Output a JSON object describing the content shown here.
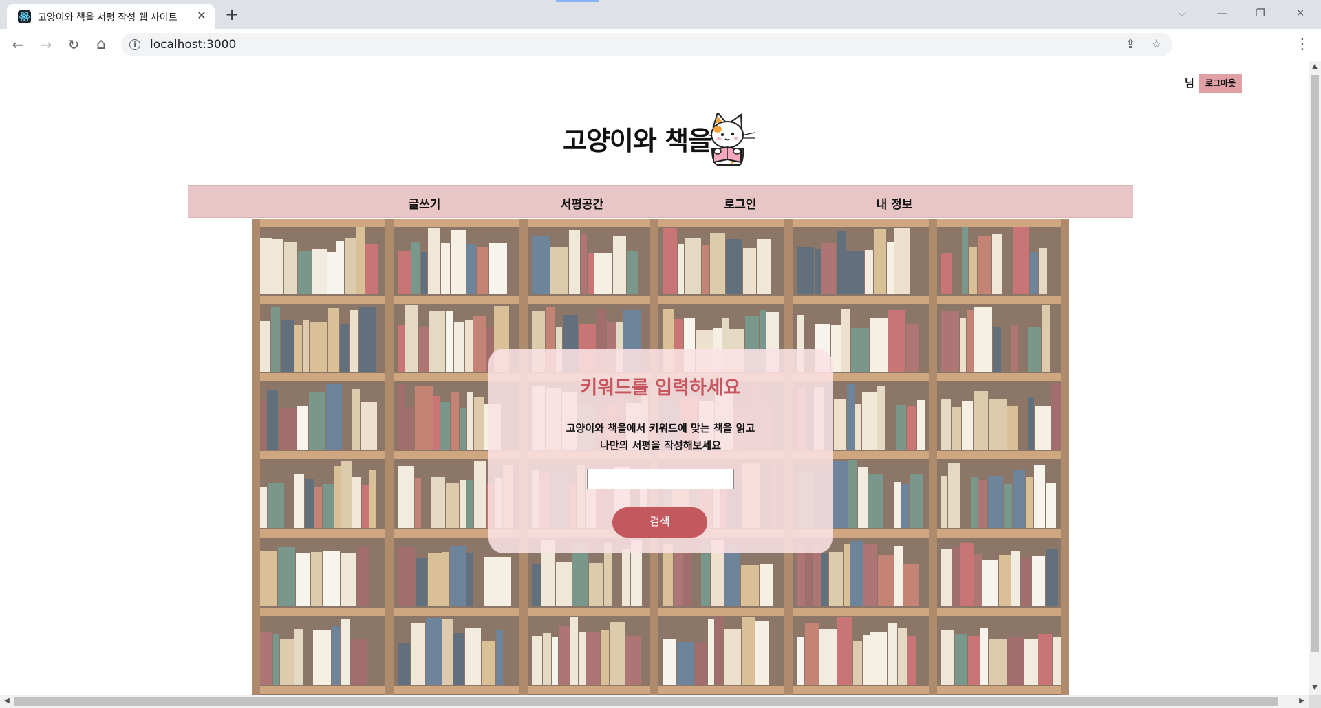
{
  "browser": {
    "tab_title": "고양이와 책을 서평 작성 웹 사이트",
    "tab_close": "✕",
    "new_tab": "+",
    "url": "localhost:3000",
    "controls": {
      "tab_search": "⌵",
      "minimize": "—",
      "restore": "❐",
      "close": "✕"
    },
    "nav": {
      "back": "←",
      "forward": "→",
      "reload": "↻",
      "home": "⌂",
      "menu": "⋮"
    },
    "omnibox_icons": {
      "info": "i",
      "share": "⇪",
      "bookmark": "☆"
    }
  },
  "header": {
    "user_suffix": "님",
    "logout_label": "로그아웃",
    "site_title": "고양이와 책을"
  },
  "nav": {
    "items": [
      {
        "label": "글쓰기"
      },
      {
        "label": "서평공간"
      },
      {
        "label": "로그인"
      },
      {
        "label": "내 정보"
      }
    ]
  },
  "search": {
    "heading": "키워드를 입력하세요",
    "desc_line1": "고양이와 책을에서 키워드에 맞는 책을 읽고",
    "desc_line2": "나만의 서평을 작성해보세요",
    "input_value": "",
    "button_label": "검색"
  },
  "colors": {
    "navbar": "#e8c6c8",
    "accent": "#c3585f",
    "heading": "#c8565e",
    "logout": "#e0a0a6"
  }
}
